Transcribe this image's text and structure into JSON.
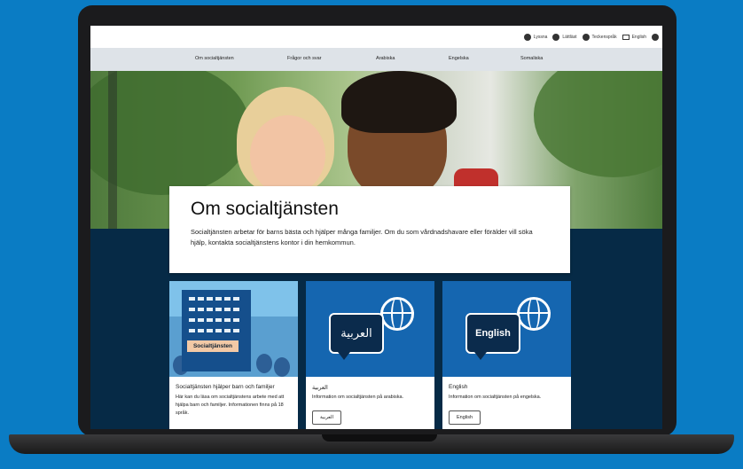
{
  "utility_bar": {
    "items": [
      {
        "label": "Lyssna",
        "icon": "speaker-icon"
      },
      {
        "label": "Lättläst",
        "icon": "easy-read-icon"
      },
      {
        "label": "Teckenspråk",
        "icon": "sign-language-icon"
      },
      {
        "label": "English",
        "icon": "book-icon"
      }
    ]
  },
  "nav": {
    "items": [
      "Om socialtjänsten",
      "Frågor och svar",
      "Arabiska",
      "Engelska",
      "Somaliska"
    ]
  },
  "intro": {
    "title": "Om socialtjänsten",
    "text": "Socialtjänsten arbetar för barns bästa och hjälper många familjer. Om du som vårdnadshavare eller förälder vill söka hjälp, kontakta socialtjänstens kontor i din hemkommun."
  },
  "cards": [
    {
      "image_sign": "Socialtjänsten",
      "title": "Socialtjänsten hjälper barn och familjer",
      "description": "Här kan du läsa om socialtjänstens arbete med att hjälpa barn och familjer. Informationen finns på 18 språk."
    },
    {
      "bubble_text": "العربية",
      "title": "العربية",
      "description": "Information om socialtjänsten på arabiska.",
      "button": "العربية"
    },
    {
      "bubble_text": "English",
      "title": "English",
      "description": "Information om socialtjänsten på engelska.",
      "button": "English"
    }
  ],
  "colors": {
    "background": "#0a7cc4",
    "nav_bg": "#dee3e8",
    "dark_band": "#062a46",
    "card_image": "#1566b0"
  }
}
